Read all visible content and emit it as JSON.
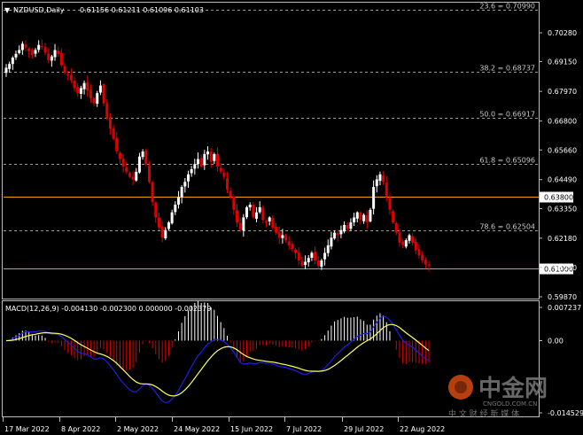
{
  "header": {
    "symbol": "NZDUSD,Daily",
    "ohlc": "0.61156 0.61211 0.61096 0.61103"
  },
  "macd": {
    "label": "MACD(12,26,9) -0.004130 -0.002300 0.000000 -0.002379"
  },
  "fibonacci": [
    {
      "label": "23.6 = 0.70990",
      "price": 0.7099
    },
    {
      "label": "38.2 = 0.68737",
      "price": 0.68737
    },
    {
      "label": "50.0 = 0.66917",
      "price": 0.66917
    },
    {
      "label": "61.8 = 0.65096",
      "price": 0.65096
    },
    {
      "label": "78.6 = 0.62504",
      "price": 0.62504
    }
  ],
  "levels": [
    {
      "label": "0.63800",
      "price": 0.638
    },
    {
      "label": "0.61000",
      "price": 0.61
    }
  ],
  "price_axis": [
    "0.70280",
    "0.69150",
    "0.67970",
    "0.66800",
    "0.65660",
    "0.64490",
    "0.63350",
    "0.62180",
    "0.61030",
    "0.59870"
  ],
  "macd_axis": [
    "0.007237",
    "0.00",
    "-0.014529"
  ],
  "date_axis": [
    "17 Mar 2022",
    "8 Apr 2022",
    "2 May 2022",
    "24 May 2022",
    "15 Jun 2022",
    "7 Jul 2022",
    "29 Jul 2022",
    "22 Aug 2022"
  ],
  "watermark": {
    "brand": "中金网",
    "domain": "CNGOLD.COM.CN",
    "tagline": "中 文 财 经 新 媒 体"
  },
  "colors": {
    "bull": "#ffffff",
    "bear": "#e00000",
    "level_line": "#f0a000",
    "signal": "#ffff64",
    "macd_line": "#1e1ee6",
    "hist_pos": "#ffffff",
    "hist_neg": "#e00000"
  },
  "chart_data": {
    "type": "candlestick",
    "symbol": "NZDUSD",
    "timeframe": "Daily",
    "price_ylim": [
      0.5987,
      0.7099
    ],
    "candles_close": [
      0.689,
      0.6905,
      0.693,
      0.6945,
      0.696,
      0.6985,
      0.697,
      0.6955,
      0.694,
      0.696,
      0.698,
      0.6975,
      0.695,
      0.692,
      0.6935,
      0.696,
      0.6945,
      0.69,
      0.687,
      0.686,
      0.684,
      0.681,
      0.679,
      0.681,
      0.683,
      0.68,
      0.677,
      0.675,
      0.679,
      0.682,
      0.675,
      0.669,
      0.665,
      0.661,
      0.656,
      0.653,
      0.65,
      0.648,
      0.646,
      0.645,
      0.648,
      0.654,
      0.656,
      0.651,
      0.644,
      0.636,
      0.63,
      0.626,
      0.622,
      0.625,
      0.628,
      0.632,
      0.635,
      0.638,
      0.642,
      0.644,
      0.647,
      0.649,
      0.651,
      0.653,
      0.65,
      0.655,
      0.656,
      0.652,
      0.655,
      0.65,
      0.648,
      0.646,
      0.641,
      0.638,
      0.633,
      0.628,
      0.625,
      0.63,
      0.634,
      0.635,
      0.63,
      0.632,
      0.634,
      0.629,
      0.628,
      0.63,
      0.626,
      0.624,
      0.622,
      0.623,
      0.621,
      0.619,
      0.6175,
      0.616,
      0.613,
      0.611,
      0.6125,
      0.614,
      0.616,
      0.613,
      0.611,
      0.613,
      0.616,
      0.619,
      0.622,
      0.624,
      0.623,
      0.625,
      0.627,
      0.6255,
      0.628,
      0.63,
      0.632,
      0.629,
      0.631,
      0.628,
      0.633,
      0.642,
      0.645,
      0.647,
      0.644,
      0.638,
      0.633,
      0.628,
      0.624,
      0.62,
      0.619,
      0.621,
      0.623,
      0.62,
      0.617,
      0.615,
      0.613,
      0.6115,
      0.611
    ]
  }
}
